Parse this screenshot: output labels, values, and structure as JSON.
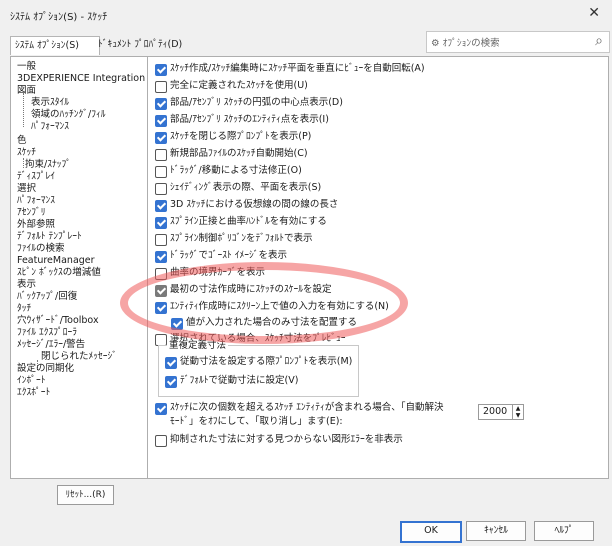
{
  "window": {
    "title": "ｼｽﾃﾑ ｵﾌﾟｼｮﾝ(S) - ｽｹｯﾁ",
    "close_icon": "close-icon"
  },
  "tabs": [
    "ｼｽﾃﾑ ｵﾌﾟｼｮﾝ(S)",
    "ﾄﾞｷｭﾒﾝﾄ ﾌﾟﾛﾊﾟﾃｨ(D)"
  ],
  "search": {
    "placeholder": "ｵﾌﾟｼｮﾝの検索",
    "icon": "search-icon"
  },
  "tree": [
    "一般",
    "3DEXPERIENCE Integration",
    "図面",
    "表示ｽﾀｲﾙ",
    "領域のﾊｯﾁﾝｸﾞ/ﾌｨﾙ",
    "ﾊﾟﾌｫｰﾏﾝｽ",
    "色",
    "ｽｹｯﾁ",
    "拘束/ｽﾅｯﾌﾟ",
    "ﾃﾞｨｽﾌﾟﾚｲ",
    "選択",
    "ﾊﾟﾌｫｰﾏﾝｽ",
    "ｱｾﾝﾌﾞﾘ",
    "外部参照",
    "ﾃﾞﾌｫﾙﾄ ﾃﾝﾌﾟﾚｰﾄ",
    "ﾌｧｲﾙの検索",
    "FeatureManager",
    "ｽﾋﾟﾝ ﾎﾞｯｸｽの増減値",
    "表示",
    "ﾊﾞｯｸｱｯﾌﾟ/回復",
    "ﾀｯﾁ",
    "穴ｳｨｻﾞｰﾄﾞ/Toolbox",
    "ﾌｧｲﾙ ｴｸｽﾌﾟﾛｰﾗ",
    "ﾒｯｾｰｼﾞ/ｴﾗｰ/警告",
    "閉じられたﾒｯｾｰｼﾞ",
    "設定の同期化",
    "ｲﾝﾎﾟｰﾄ",
    "ｴｸｽﾎﾟｰﾄ"
  ],
  "reset_label": "ﾘｾｯﾄ...(R)",
  "options": [
    {
      "label": "ｽｹｯﾁ作成/ｽｹｯﾁ編集時にｽｹｯﾁ平面を垂直にﾋﾞｭｰを自動回転(A)",
      "checked": true
    },
    {
      "label": "完全に定義されたｽｹｯﾁを使用(U)",
      "checked": false
    },
    {
      "label": "部品/ｱｾﾝﾌﾞﾘ ｽｹｯﾁの円弧の中心点表示(D)",
      "checked": true
    },
    {
      "label": "部品/ｱｾﾝﾌﾞﾘ ｽｹｯﾁのｴﾝﾃｨﾃｨ点を表示(I)",
      "checked": true
    },
    {
      "label": "ｽｹｯﾁを閉じる際ﾌﾟﾛﾝﾌﾟﾄを表示(P)",
      "checked": true
    },
    {
      "label": "新規部品ﾌｧｲﾙのｽｹｯﾁ自動開始(C)",
      "checked": false
    },
    {
      "label": "ﾄﾞﾗｯｸﾞ/移動による寸法修正(O)",
      "checked": false
    },
    {
      "label": "ｼｪｲﾃﾞｨﾝｸﾞ表示の際、平面を表示(S)",
      "checked": false
    },
    {
      "label": "3D ｽｹｯﾁにおける仮想線の間の線の長さ",
      "checked": true
    },
    {
      "label": "ｽﾌﾟﾗｲﾝ正接と曲率ﾊﾝﾄﾞﾙを有効にする",
      "checked": true
    },
    {
      "label": "ｽﾌﾟﾗｲﾝ制御ﾎﾟﾘｺﾞﾝをﾃﾞﾌｫﾙﾄで表示",
      "checked": false
    },
    {
      "label": "ﾄﾞﾗｯｸﾞでｺﾞｰｽﾄ ｲﾒｰｼﾞを表示",
      "checked": true
    },
    {
      "label": "曲率の境界ｶｰﾌﾞを表示",
      "checked": false
    },
    {
      "label": "最初の寸法作成時にｽｹｯﾁのｽｹｰﾙを設定",
      "checked": true,
      "gray": true
    },
    {
      "label": "ｴﾝﾃｨﾃｨ作成時にｽｸﾘｰﾝ上で値の入力を有効にする(N)",
      "checked": true
    },
    {
      "label": "値が入力された場合のみ寸法を配置する",
      "checked": true
    },
    {
      "label": "選択されている場合、ｽｹｯﾁ寸法をﾌﾟﾚﾋﾞｭｰ",
      "checked": false
    }
  ],
  "overdefined": {
    "title": "重複定義寸法",
    "items": [
      {
        "label": "従動寸法を設定する際ﾌﾟﾛﾝﾌﾟﾄを表示(M)",
        "checked": true
      },
      {
        "label": "ﾃﾞﾌｫﾙﾄで従動寸法に設定(V)",
        "checked": true
      }
    ]
  },
  "auto_solve": {
    "line1": "ｽｹｯﾁに次の個数を超えるｽｹｯﾁ ｴﾝﾃｨﾃｨが含まれる場合、「自動解決",
    "line2": "ﾓｰﾄﾞ」をｵﾌにして、「取り消し」ます(E):",
    "checked": true,
    "value": "2000"
  },
  "suppress_error": {
    "label": "抑制された寸法に対する見つからない図形ｴﾗｰを非表示",
    "checked": false
  },
  "buttons": {
    "ok": "OK",
    "cancel": "ｷｬﾝｾﾙ",
    "help": "ﾍﾙﾌﾟ"
  },
  "accent_color": "#3473d1",
  "highlight_color": "#ee5b5b"
}
